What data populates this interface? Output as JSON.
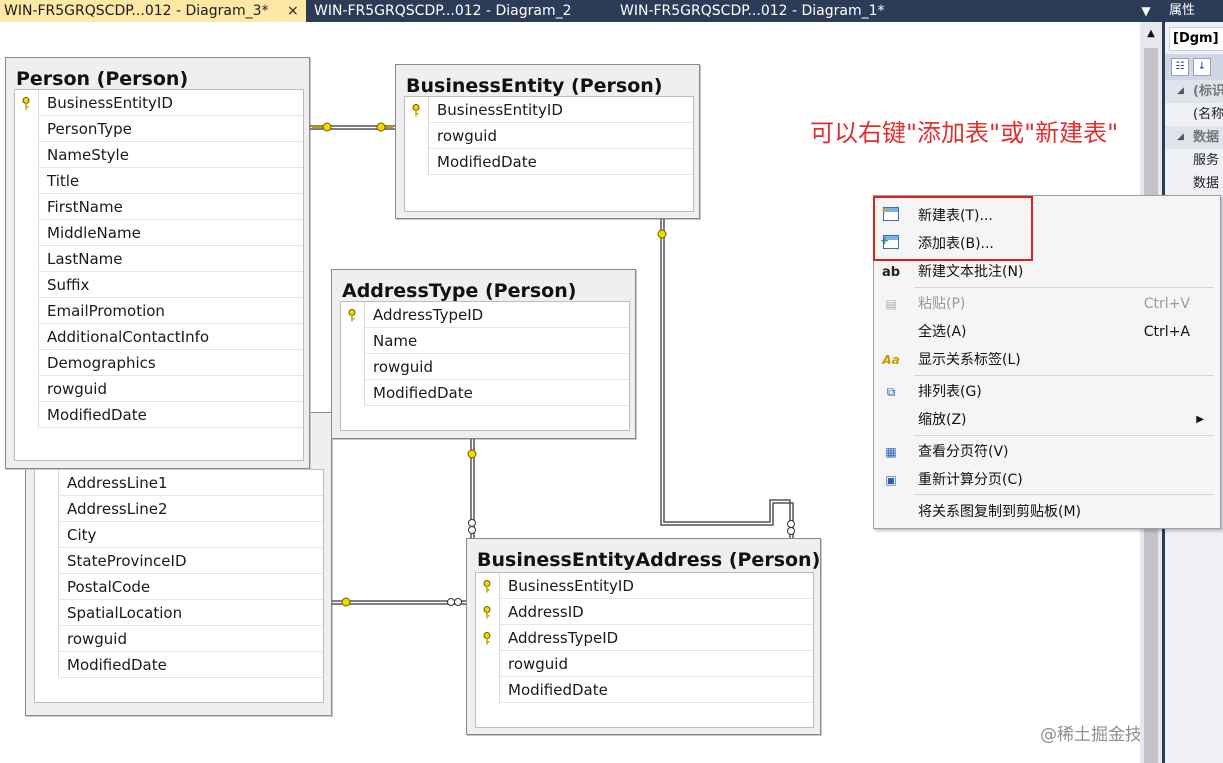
{
  "tabs": [
    {
      "label": "WIN-FR5GRQSCDP...012 - Diagram_3*",
      "active": true
    },
    {
      "label": "WIN-FR5GRQSCDP...012 - Diagram_2",
      "active": false
    },
    {
      "label": "WIN-FR5GRQSCDP...012 - Diagram_1*",
      "active": false
    }
  ],
  "tab_close_glyph": "×",
  "tables": {
    "person": {
      "title": "Person (Person)",
      "columns": [
        {
          "name": "BusinessEntityID",
          "key": true
        },
        {
          "name": "PersonType",
          "key": false
        },
        {
          "name": "NameStyle",
          "key": false
        },
        {
          "name": "Title",
          "key": false
        },
        {
          "name": "FirstName",
          "key": false
        },
        {
          "name": "MiddleName",
          "key": false
        },
        {
          "name": "LastName",
          "key": false
        },
        {
          "name": "Suffix",
          "key": false
        },
        {
          "name": "EmailPromotion",
          "key": false
        },
        {
          "name": "AdditionalContactInfo",
          "key": false
        },
        {
          "name": "Demographics",
          "key": false
        },
        {
          "name": "rowguid",
          "key": false
        },
        {
          "name": "ModifiedDate",
          "key": false
        }
      ]
    },
    "business_entity": {
      "title": "BusinessEntity (Person)",
      "columns": [
        {
          "name": "BusinessEntityID",
          "key": true
        },
        {
          "name": "rowguid",
          "key": false
        },
        {
          "name": "ModifiedDate",
          "key": false
        }
      ]
    },
    "address_type": {
      "title": "AddressType (Person)",
      "columns": [
        {
          "name": "AddressTypeID",
          "key": true
        },
        {
          "name": "Name",
          "key": false
        },
        {
          "name": "rowguid",
          "key": false
        },
        {
          "name": "ModifiedDate",
          "key": false
        }
      ]
    },
    "address": {
      "columns": [
        {
          "name": "AddressLine1",
          "key": false
        },
        {
          "name": "AddressLine2",
          "key": false
        },
        {
          "name": "City",
          "key": false
        },
        {
          "name": "StateProvinceID",
          "key": false
        },
        {
          "name": "PostalCode",
          "key": false
        },
        {
          "name": "SpatialLocation",
          "key": false
        },
        {
          "name": "rowguid",
          "key": false
        },
        {
          "name": "ModifiedDate",
          "key": false
        }
      ]
    },
    "business_entity_address": {
      "title": "BusinessEntityAddress (Person)",
      "columns": [
        {
          "name": "BusinessEntityID",
          "key": true
        },
        {
          "name": "AddressID",
          "key": true
        },
        {
          "name": "AddressTypeID",
          "key": true
        },
        {
          "name": "rowguid",
          "key": false
        },
        {
          "name": "ModifiedDate",
          "key": false
        }
      ]
    }
  },
  "annotation": "可以右键\"添加表\"或\"新建表\"",
  "context_menu": {
    "items": [
      {
        "label": "新建表(T)...",
        "shortcut": "",
        "icon": "new-table-icon",
        "disabled": false
      },
      {
        "label": "添加表(B)...",
        "shortcut": "",
        "icon": "add-table-icon",
        "disabled": false
      },
      {
        "label": "新建文本批注(N)",
        "shortcut": "",
        "icon": "text-annotation-icon",
        "disabled": false
      },
      {
        "label": "粘贴(P)",
        "shortcut": "Ctrl+V",
        "icon": "paste-icon",
        "disabled": true
      },
      {
        "label": "全选(A)",
        "shortcut": "Ctrl+A",
        "icon": "",
        "disabled": false
      },
      {
        "label": "显示关系标签(L)",
        "shortcut": "",
        "icon": "relationship-labels-icon",
        "disabled": false
      },
      {
        "label": "排列表(G)",
        "shortcut": "",
        "icon": "arrange-tables-icon",
        "disabled": false
      },
      {
        "label": "缩放(Z)",
        "shortcut": "",
        "icon": "",
        "disabled": false,
        "submenu": true
      },
      {
        "label": "查看分页符(V)",
        "shortcut": "",
        "icon": "page-breaks-icon",
        "disabled": false
      },
      {
        "label": "重新计算分页(C)",
        "shortcut": "",
        "icon": "recalculate-pages-icon",
        "disabled": false
      },
      {
        "label": "将关系图复制到剪贴板(M)",
        "shortcut": "",
        "icon": "",
        "disabled": false
      }
    ]
  },
  "properties_panel": {
    "title": "属性",
    "object": "[Dgm]",
    "rows": [
      {
        "label": "(标识",
        "category": true
      },
      {
        "label": "(名称",
        "category": false
      },
      {
        "label": "数据",
        "category": true
      },
      {
        "label": "服务",
        "category": false
      },
      {
        "label": "数据",
        "category": false
      },
      {
        "label": "",
        "category": false
      }
    ]
  },
  "watermark": "@稀土掘金技术社区",
  "colors": {
    "tab_strip": "#2b3c59",
    "active_tab": "#ffe8a6",
    "annotation": "#e03030",
    "highlight_box": "#e02020",
    "key_icon": "#f2d600"
  }
}
